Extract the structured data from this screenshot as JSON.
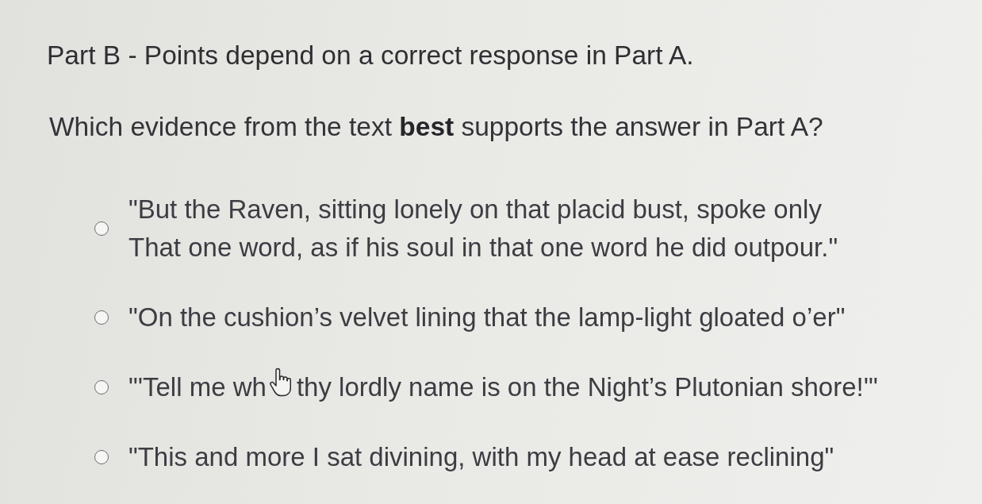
{
  "heading": "Part B - Points depend on a correct response in Part A.",
  "question": "Which evidence from the text **best** supports the answer in Part A?",
  "options": [
    {
      "kind": "lines",
      "selected": false,
      "lines": [
        "\"But the Raven, sitting lonely on that placid bust, spoke only",
        "That one word, as if his soul in that one word he did outpour.\""
      ]
    },
    {
      "kind": "lines",
      "selected": false,
      "lines": [
        "\"On the cushion’s velvet lining that the lamp-light gloated o’er\""
      ]
    },
    {
      "kind": "pointer_over",
      "selected": false,
      "lines": [
        "\"'Tell me wh",
        "thy lordly name is on the Night’s Plutonian shore!'\""
      ]
    },
    {
      "kind": "lines",
      "selected": false,
      "lines": [
        "\"This and more I sat divining, with my head at ease reclining\""
      ]
    }
  ]
}
